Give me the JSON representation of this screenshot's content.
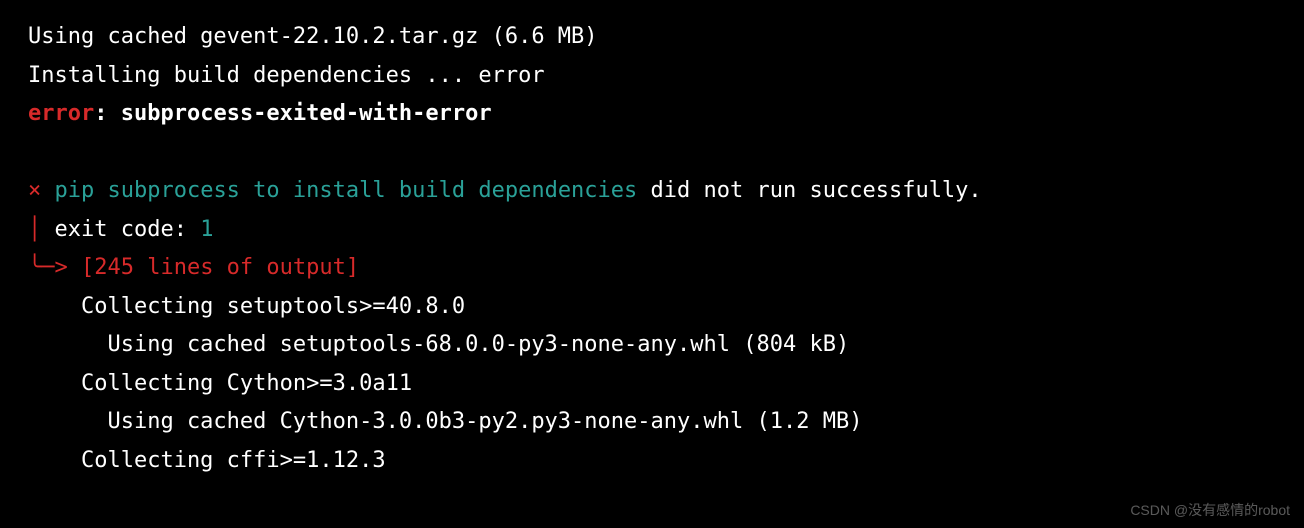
{
  "lines": {
    "l1": "Using cached gevent-22.10.2.tar.gz (6.6 MB)",
    "l2": "Installing build dependencies ... error",
    "l3_error": "error",
    "l3_colon": ": ",
    "l3_msg": "subprocess-exited-with-error",
    "l4": "",
    "l5_x": "× ",
    "l5_cyan": "pip subprocess to install build dependencies",
    "l5_rest": " did not run successfully.",
    "l6_bar": "│ ",
    "l6_txt": "exit code: ",
    "l6_code": "1",
    "l7_arrow": "╰─> ",
    "l7_txt": "[245 lines of output]",
    "l8": "    Collecting setuptools>=40.8.0",
    "l9": "      Using cached setuptools-68.0.0-py3-none-any.whl (804 kB)",
    "l10": "    Collecting Cython>=3.0a11",
    "l11": "      Using cached Cython-3.0.0b3-py2.py3-none-any.whl (1.2 MB)",
    "l12": "    Collecting cffi>=1.12.3"
  },
  "watermark": "CSDN @没有感情的robot"
}
